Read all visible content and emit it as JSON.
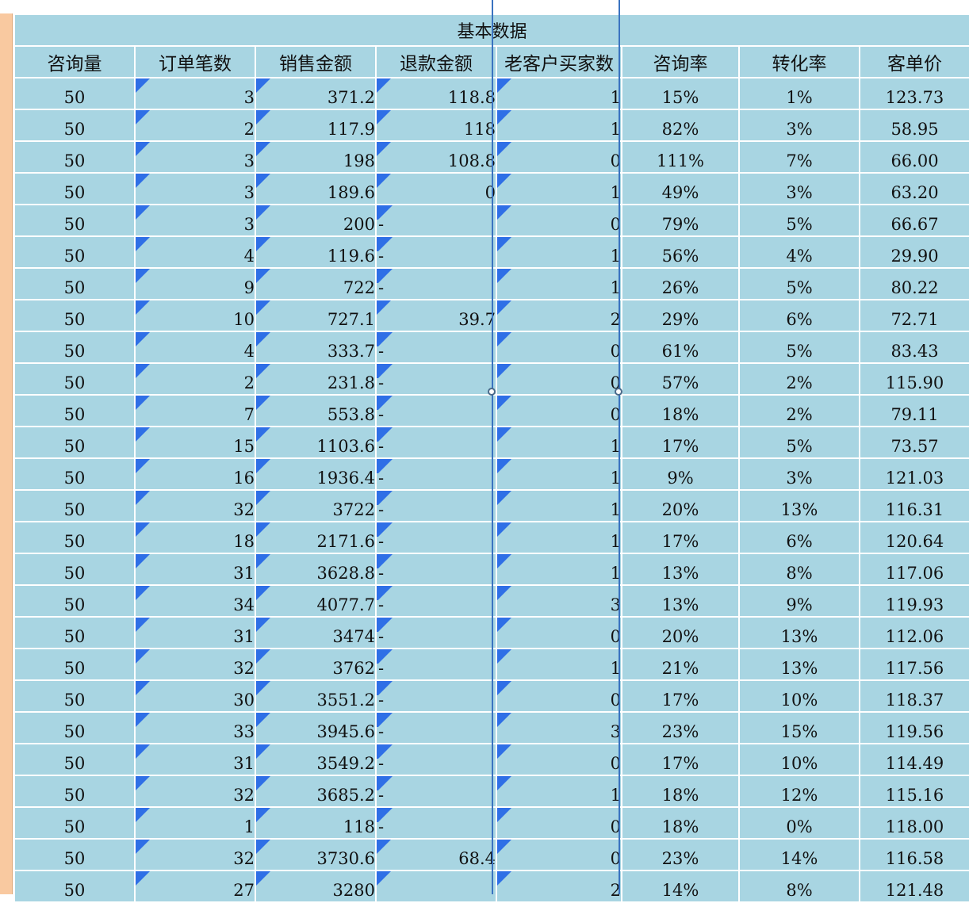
{
  "sheet": {
    "banner": "基本数据",
    "headers": [
      "咨询量",
      "订单笔数",
      "销售金额",
      "退款金额",
      "老客户买家数",
      "咨询率",
      "转化率",
      "客单价"
    ],
    "rows": [
      [
        "50",
        "3",
        "371.2",
        "118.8",
        "1",
        "15%",
        "1%",
        "123.73"
      ],
      [
        "50",
        "2",
        "117.9",
        "118",
        "1",
        "82%",
        "3%",
        "58.95"
      ],
      [
        "50",
        "3",
        "198",
        "108.8",
        "0",
        "111%",
        "7%",
        "66.00"
      ],
      [
        "50",
        "3",
        "189.6",
        "0",
        "1",
        "49%",
        "3%",
        "63.20"
      ],
      [
        "50",
        "3",
        "200",
        "-",
        "0",
        "79%",
        "5%",
        "66.67"
      ],
      [
        "50",
        "4",
        "119.6",
        "-",
        "1",
        "56%",
        "4%",
        "29.90"
      ],
      [
        "50",
        "9",
        "722",
        "-",
        "1",
        "26%",
        "5%",
        "80.22"
      ],
      [
        "50",
        "10",
        "727.1",
        "39.7",
        "2",
        "29%",
        "6%",
        "72.71"
      ],
      [
        "50",
        "4",
        "333.7",
        "-",
        "0",
        "61%",
        "5%",
        "83.43"
      ],
      [
        "50",
        "2",
        "231.8",
        "-",
        "0",
        "57%",
        "2%",
        "115.90"
      ],
      [
        "50",
        "7",
        "553.8",
        "-",
        "0",
        "18%",
        "2%",
        "79.11"
      ],
      [
        "50",
        "15",
        "1103.6",
        "-",
        "1",
        "17%",
        "5%",
        "73.57"
      ],
      [
        "50",
        "16",
        "1936.4",
        "-",
        "1",
        "9%",
        "3%",
        "121.03"
      ],
      [
        "50",
        "32",
        "3722",
        "-",
        "1",
        "20%",
        "13%",
        "116.31"
      ],
      [
        "50",
        "18",
        "2171.6",
        "-",
        "1",
        "17%",
        "6%",
        "120.64"
      ],
      [
        "50",
        "31",
        "3628.8",
        "-",
        "1",
        "13%",
        "8%",
        "117.06"
      ],
      [
        "50",
        "34",
        "4077.7",
        "-",
        "3",
        "13%",
        "9%",
        "119.93"
      ],
      [
        "50",
        "31",
        "3474",
        "-",
        "0",
        "20%",
        "13%",
        "112.06"
      ],
      [
        "50",
        "32",
        "3762",
        "-",
        "1",
        "21%",
        "13%",
        "117.56"
      ],
      [
        "50",
        "30",
        "3551.2",
        "-",
        "0",
        "17%",
        "10%",
        "118.37"
      ],
      [
        "50",
        "33",
        "3945.6",
        "-",
        "3",
        "23%",
        "15%",
        "119.56"
      ],
      [
        "50",
        "31",
        "3549.2",
        "-",
        "0",
        "17%",
        "10%",
        "114.49"
      ],
      [
        "50",
        "32",
        "3685.2",
        "-",
        "1",
        "18%",
        "12%",
        "115.16"
      ],
      [
        "50",
        "1",
        "118",
        "-",
        "0",
        "18%",
        "0%",
        "118.00"
      ],
      [
        "50",
        "32",
        "3730.6",
        "68.4",
        "0",
        "23%",
        "14%",
        "116.58"
      ],
      [
        "50",
        "27",
        "3280",
        "",
        "2",
        "14%",
        "8%",
        "121.48"
      ]
    ]
  },
  "colors": {
    "cell_bg": "#a8d5e2",
    "row_header_strip": "#f9c9a0",
    "comment_marker": "#2f6fe6",
    "selection_line": "#3a73c0"
  }
}
